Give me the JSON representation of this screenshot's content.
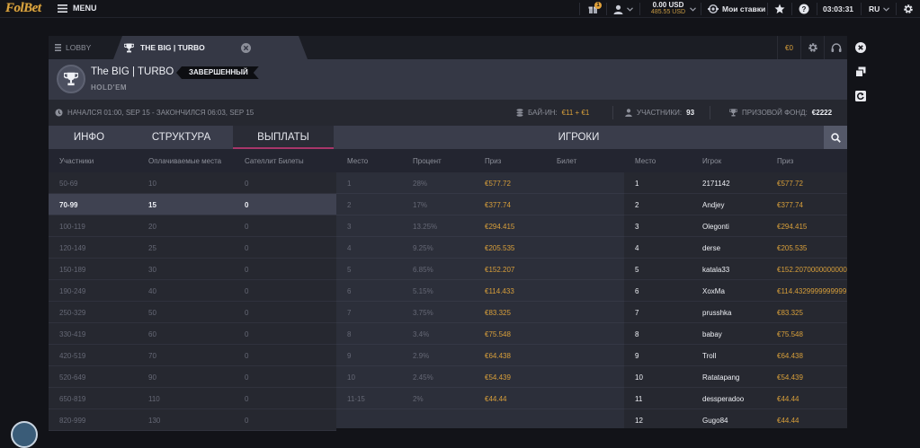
{
  "topbar": {
    "logo": "FolBet",
    "menu_label": "MENU",
    "gift_count": "1",
    "balance_main": "0.00 USD",
    "balance_sub": "485.55 USD",
    "my_bets_label": "Мои ставки",
    "clock": "03:03:31",
    "language": "RU"
  },
  "tabs": {
    "lobby_label": "LOBBY",
    "active_label": "THE BIG | TURBO",
    "balance_cell": "€0"
  },
  "header": {
    "title": "The BIG | TURBO",
    "status": "ЗАВЕРШЕННЫЙ",
    "game_type": "HOLD'EM"
  },
  "infobar": {
    "time_range": "НАЧАЛСЯ 01:00, SEP 15 - ЗАКОНЧИЛСЯ 06:03, SEP 15",
    "buyin_label": "БАЙ-ИН:",
    "buyin_value": "€11 + €1",
    "participants_label": "УЧАСТНИКИ:",
    "participants_value": "93",
    "prizepool_label": "ПРИЗОВОЙ ФОНД:",
    "prizepool_value": "€2222"
  },
  "section_tabs": {
    "info": "ИНФО",
    "structure": "СТРУКТУРА",
    "payouts": "ВЫПЛАТЫ",
    "players": "ИГРОКИ"
  },
  "column_headers": {
    "participants": "Участники",
    "paid_places": "Оплачиваемые места",
    "satellite": "Сателлит Билеты",
    "place": "Место",
    "percent": "Процент",
    "prize": "Приз",
    "ticket": "Билет",
    "p_place": "Место",
    "p_player": "Игрок",
    "p_prize": "Приз"
  },
  "payout_levels": [
    {
      "range": "50-69",
      "paid": "10",
      "sat": "0"
    },
    {
      "range": "70-99",
      "paid": "15",
      "sat": "0"
    },
    {
      "range": "100-119",
      "paid": "20",
      "sat": "0"
    },
    {
      "range": "120-149",
      "paid": "25",
      "sat": "0"
    },
    {
      "range": "150-189",
      "paid": "30",
      "sat": "0"
    },
    {
      "range": "190-249",
      "paid": "40",
      "sat": "0"
    },
    {
      "range": "250-329",
      "paid": "50",
      "sat": "0"
    },
    {
      "range": "330-419",
      "paid": "60",
      "sat": "0"
    },
    {
      "range": "420-519",
      "paid": "70",
      "sat": "0"
    },
    {
      "range": "520-649",
      "paid": "90",
      "sat": "0"
    },
    {
      "range": "650-819",
      "paid": "110",
      "sat": "0"
    },
    {
      "range": "820-999",
      "paid": "130",
      "sat": "0"
    }
  ],
  "prize_table": [
    {
      "place": "1",
      "percent": "28%",
      "prize": "€577.72",
      "ticket": ""
    },
    {
      "place": "2",
      "percent": "17%",
      "prize": "€377.74",
      "ticket": ""
    },
    {
      "place": "3",
      "percent": "13.25%",
      "prize": "€294.415",
      "ticket": ""
    },
    {
      "place": "4",
      "percent": "9.25%",
      "prize": "€205.535",
      "ticket": ""
    },
    {
      "place": "5",
      "percent": "6.85%",
      "prize": "€152.207",
      "ticket": ""
    },
    {
      "place": "6",
      "percent": "5.15%",
      "prize": "€114.433",
      "ticket": ""
    },
    {
      "place": "7",
      "percent": "3.75%",
      "prize": "€83.325",
      "ticket": ""
    },
    {
      "place": "8",
      "percent": "3.4%",
      "prize": "€75.548",
      "ticket": ""
    },
    {
      "place": "9",
      "percent": "2.9%",
      "prize": "€64.438",
      "ticket": ""
    },
    {
      "place": "10",
      "percent": "2.45%",
      "prize": "€54.439",
      "ticket": ""
    },
    {
      "place": "11-15",
      "percent": "2%",
      "prize": "€44.44",
      "ticket": ""
    }
  ],
  "players": [
    {
      "place": "1",
      "name": "2171142",
      "prize": "€577.72"
    },
    {
      "place": "2",
      "name": "Andjey",
      "prize": "€377.74"
    },
    {
      "place": "3",
      "name": "Olegonti",
      "prize": "€294.415"
    },
    {
      "place": "4",
      "name": "derse",
      "prize": "€205.535"
    },
    {
      "place": "5",
      "name": "katala33",
      "prize": "€152.2070000000000"
    },
    {
      "place": "6",
      "name": "XoxMa",
      "prize": "€114.4329999999999"
    },
    {
      "place": "7",
      "name": "prusshka",
      "prize": "€83.325"
    },
    {
      "place": "8",
      "name": "babay",
      "prize": "€75.548"
    },
    {
      "place": "9",
      "name": "Troll",
      "prize": "€64.438"
    },
    {
      "place": "10",
      "name": "Ratatapang",
      "prize": "€54.439"
    },
    {
      "place": "11",
      "name": "dessperadoo",
      "prize": "€44.44"
    },
    {
      "place": "12",
      "name": "Gugo84",
      "prize": "€44.44"
    }
  ],
  "selected_level_index": 1
}
